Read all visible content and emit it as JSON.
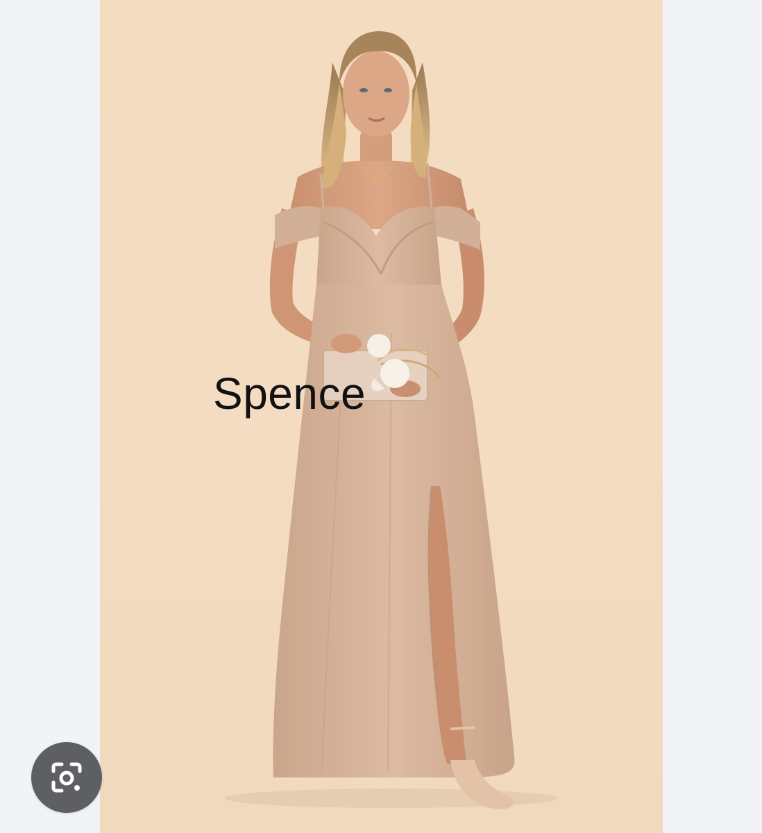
{
  "photo": {
    "caption": "Spence",
    "background_color": "#f3dcc2",
    "dress_color": "#d7b59c"
  },
  "overlay": {
    "lens_button_icon": "google-lens-camera-icon",
    "lens_button_color": "#5d5f63"
  }
}
